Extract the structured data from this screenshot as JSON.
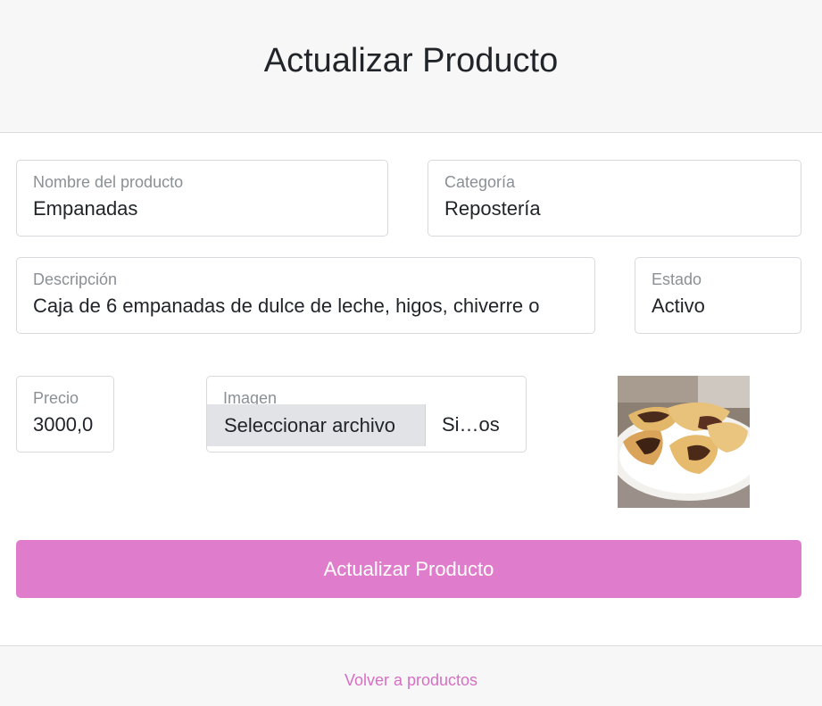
{
  "header": {
    "title": "Actualizar Producto"
  },
  "form": {
    "nombre": {
      "label": "Nombre del producto",
      "value": "Empanadas"
    },
    "categoria": {
      "label": "Categoría",
      "value": "Repostería"
    },
    "descripcion": {
      "label": "Descripción",
      "value": "Caja de 6 empanadas de dulce de leche, higos, chiverre o"
    },
    "estado": {
      "label": "Estado",
      "value": "Activo"
    },
    "precio": {
      "label": "Precio",
      "value": "3000,0"
    },
    "imagen": {
      "label": "Imagen",
      "button_label": "Seleccionar archivo",
      "status": "Si…os"
    },
    "submit_label": "Actualizar Producto"
  },
  "footer": {
    "link_label": "Volver a productos"
  },
  "colors": {
    "accent": "#e07ccc",
    "link": "#d76fc4",
    "header_bg": "#f7f7f7"
  }
}
